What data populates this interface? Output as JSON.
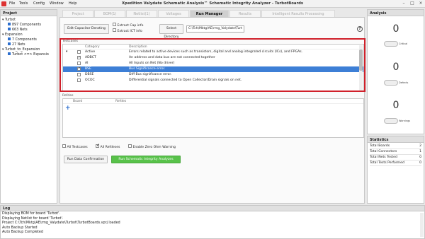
{
  "window": {
    "title": "Xpedition Valydate Schematic Analysis™ Schematic Integrity Analyzer - TurbotBoards",
    "menus": [
      "File",
      "Tools",
      "Config",
      "Window",
      "Help"
    ]
  },
  "project": {
    "title": "Project",
    "tree": [
      {
        "label": "Turbot",
        "level": 0
      },
      {
        "label": "897 Components",
        "level": 1
      },
      {
        "label": "663 Nets",
        "level": 1
      },
      {
        "label": "Expansion",
        "level": 0
      },
      {
        "label": "7 Components",
        "level": 1
      },
      {
        "label": "27 Nets",
        "level": 1
      },
      {
        "label": "Turbot_to_Expansion",
        "level": 0
      },
      {
        "label": "Turbot <=> Expansio",
        "level": 1
      }
    ]
  },
  "tabs": [
    "Project",
    "BOM(1)",
    "Netlist(1)",
    "Voltages",
    "Run Manager",
    "Results",
    "Intelligent Results Processing"
  ],
  "toolbar": {
    "edit_cap": "Edit Capacitor Derating",
    "extract_cap": "Extract Cap info",
    "extract_ict": "Extract ICT info",
    "select_dir": "Select Directory",
    "dir_path": "C:\\Tch\\Mktg\\AE\\rmg_Valydate\\Turt",
    "help": "?"
  },
  "testcases": {
    "label": "Testcases",
    "headers": [
      "Category",
      "Description"
    ],
    "rows": [
      {
        "category": "Active",
        "description": "Errors related to active devices such as transistors, digital and analog integrated circuits (ICs), and FPGAs.",
        "checked": false,
        "expanded": true,
        "selected": false
      },
      {
        "category": "ADBCT",
        "description": "An address and data bus are not connected together",
        "checked": true,
        "selected": false
      },
      {
        "category": "AI",
        "description": "All Inputs on Net (No driver)",
        "checked": false,
        "selected": false
      },
      {
        "category": "BSE",
        "description": "Bus Significance error.",
        "checked": true,
        "selected": true
      },
      {
        "category": "DBSE",
        "description": "Diff Bus significance error.",
        "checked": false,
        "selected": false
      },
      {
        "category": "OCOC",
        "description": "Differential signals connected to Open Collector/Drain signals on net.",
        "checked": false,
        "selected": false
      }
    ]
  },
  "refdes": {
    "label": "Refdes",
    "headers": [
      "Board",
      "Refdes"
    ]
  },
  "options": {
    "all_testcases": "All Testcases",
    "all_refdes": "All Refdeses",
    "zero_ohm": "Enable Zero Ohm Warning"
  },
  "actions": {
    "run_data": "Run Data Confirmation",
    "run_sia": "Run Schematic Integrity Analyzes"
  },
  "analysis": {
    "title": "Analysis",
    "items": [
      {
        "value": "0",
        "label": "Critical"
      },
      {
        "value": "0",
        "label": "Defects"
      },
      {
        "value": "0",
        "label": "Warnings"
      }
    ]
  },
  "statistics": {
    "title": "Statistics",
    "rows": [
      {
        "label": "Total Boards",
        "value": "2"
      },
      {
        "label": "Total Connectors",
        "value": "1"
      },
      {
        "label": "Total Nets Tested",
        "value": "0"
      },
      {
        "label": "Total Tests Performed",
        "value": "0"
      }
    ]
  },
  "log": {
    "title": "Log",
    "lines": [
      "Displaying BOM for board 'Turbot'.",
      "Displaying Netlist for board 'Turbot'.",
      "Project C:\\Tch\\Mktg\\AE\\rmg_Valydate\\Turbot\\TurbotBoards.vprj loaded",
      "Auto Backup Started",
      "Auto Backup Completed"
    ]
  },
  "colors": {
    "accent": "#3d7fd6",
    "run_button": "#58c24a",
    "highlight": "#d0202a"
  }
}
